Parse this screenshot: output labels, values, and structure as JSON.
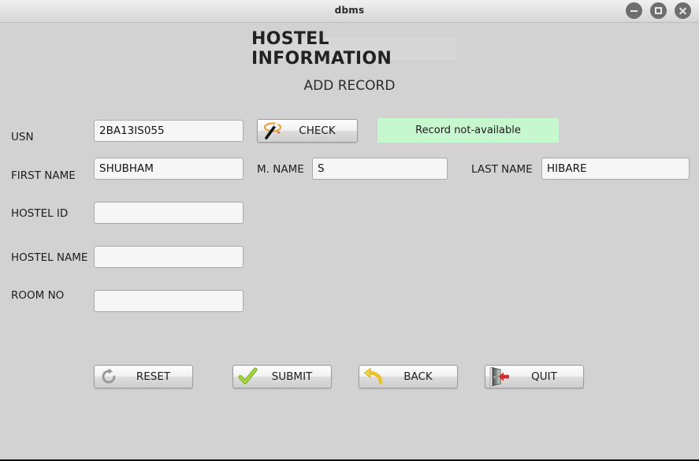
{
  "window": {
    "title": "dbms",
    "controls": [
      {
        "name": "minimize",
        "label": "−"
      },
      {
        "name": "maximize",
        "label": "□"
      },
      {
        "name": "close",
        "label": "×"
      }
    ]
  },
  "header": {
    "title": "HOSTEL INFORMATION",
    "subtitle": "ADD RECORD"
  },
  "form": {
    "usn": {
      "label": "USN",
      "value": "2BA13IS055",
      "placeholder": ""
    },
    "first_name": {
      "label": "FIRST NAME",
      "value": "SHUBHAM",
      "placeholder": ""
    },
    "middle_name": {
      "label": "M. NAME",
      "value": "S",
      "placeholder": ""
    },
    "last_name": {
      "label": "LAST NAME",
      "value": "HIBARE",
      "placeholder": ""
    },
    "hostel_id": {
      "label": "HOSTEL ID",
      "value": "",
      "placeholder": ""
    },
    "hostel_name": {
      "label": "HOSTEL NAME",
      "value": "",
      "placeholder": ""
    },
    "room_no": {
      "label": "ROOM NO",
      "value": "",
      "placeholder": ""
    }
  },
  "check_button": {
    "label": "CHECK",
    "icon": "magic-wand-icon"
  },
  "status": {
    "text": "Record not-available",
    "background": "#c6f7ce",
    "text_color": "#1a1a1a"
  },
  "actions": [
    {
      "label": "RESET",
      "icon": "refresh-icon"
    },
    {
      "label": "SUBMIT",
      "icon": "check-mark-icon"
    },
    {
      "label": "BACK",
      "icon": "back-arrow-icon"
    },
    {
      "label": "QUIT",
      "icon": "exit-door-icon"
    }
  ],
  "theme": {
    "window_background": "#d2d2d2",
    "field_background": "#f6f6f6",
    "accent_green": "#8cc63f",
    "accent_yellow": "#f4d03f",
    "accent_red": "#d32f2f",
    "accent_orange": "#e8a33d"
  }
}
